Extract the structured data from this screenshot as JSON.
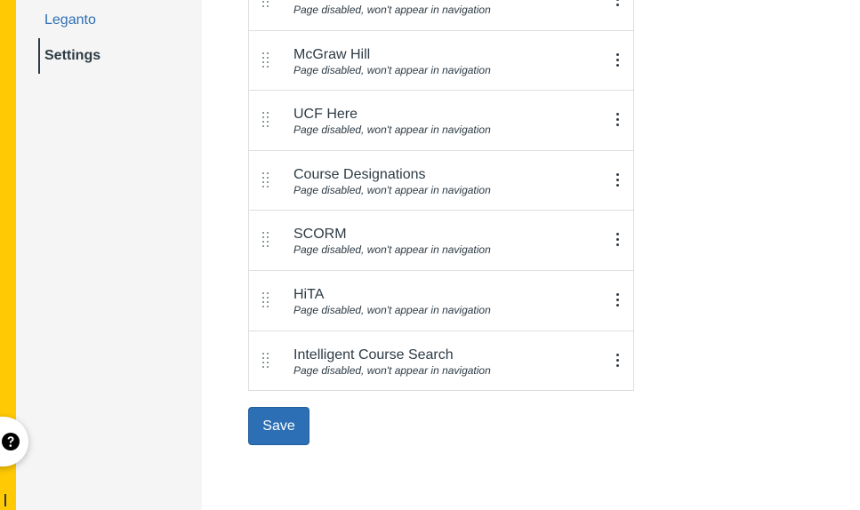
{
  "course_nav": {
    "items": [
      {
        "label": "Leganto"
      },
      {
        "label": "Settings"
      }
    ]
  },
  "tools": {
    "subtitle": "Page disabled, won't appear in navigation",
    "items": [
      {
        "name": "",
        "status": "Page disabled, won't appear in navigation"
      },
      {
        "name": "McGraw Hill",
        "status": "Page disabled, won't appear in navigation"
      },
      {
        "name": "UCF Here",
        "status": "Page disabled, won't appear in navigation"
      },
      {
        "name": "Course Designations",
        "status": "Page disabled, won't appear in navigation"
      },
      {
        "name": "SCORM",
        "status": "Page disabled, won't appear in navigation"
      },
      {
        "name": "HiTA",
        "status": "Page disabled, won't appear in navigation"
      },
      {
        "name": "Intelligent Course Search",
        "status": "Page disabled, won't appear in navigation"
      }
    ]
  },
  "actions": {
    "save_label": "Save"
  },
  "icons": {
    "help": "question-icon",
    "drag": "drag-handle-icon",
    "menu": "kebab-menu-icon"
  },
  "colors": {
    "global_nav": "#ffc904",
    "link": "#2d6fb5",
    "button": "#2d6fb5"
  }
}
